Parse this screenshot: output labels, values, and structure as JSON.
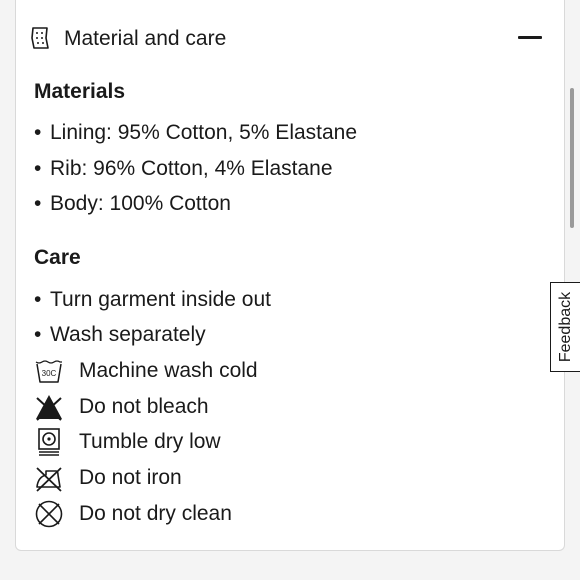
{
  "accordion": {
    "title": "Material and care",
    "header_icon": "care-label-tag-icon",
    "toggle_icon": "minus-icon"
  },
  "materials": {
    "heading": "Materials",
    "items": [
      "Lining: 95% Cotton, 5% Elastane",
      "Rib: 96% Cotton, 4% Elastane",
      "Body: 100% Cotton"
    ]
  },
  "care": {
    "heading": "Care",
    "bullets": [
      "Turn garment inside out",
      "Wash separately"
    ],
    "symbols": [
      {
        "icon": "wash-30c-icon",
        "label": "Machine wash cold",
        "symbol_text": "30C"
      },
      {
        "icon": "no-bleach-icon",
        "label": "Do not bleach"
      },
      {
        "icon": "tumble-dry-low-icon",
        "label": "Tumble dry low"
      },
      {
        "icon": "no-iron-icon",
        "label": "Do not iron"
      },
      {
        "icon": "no-dry-clean-icon",
        "label": "Do not dry clean"
      }
    ]
  },
  "feedback": {
    "label": "Feedback"
  },
  "colors": {
    "text": "#1a1a1a",
    "panel": "#ffffff",
    "background": "#f4f4f4"
  }
}
